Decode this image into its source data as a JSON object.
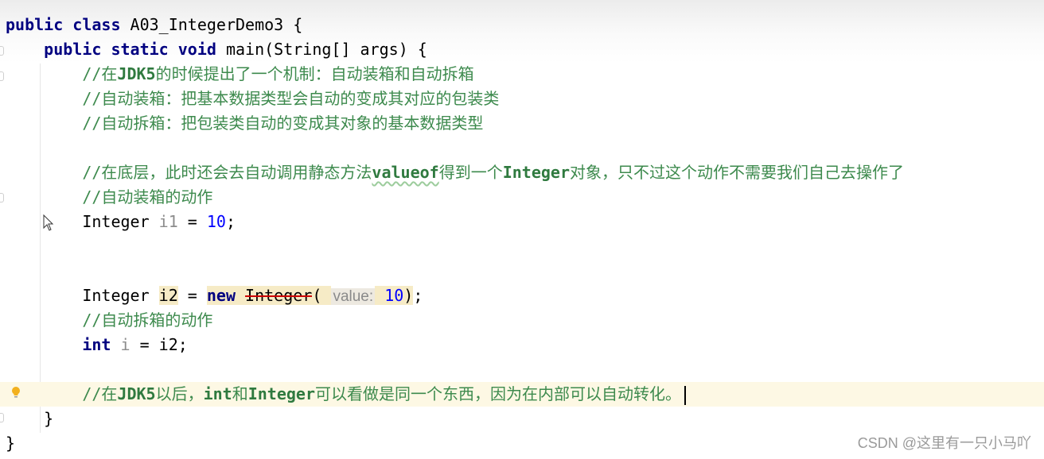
{
  "editor": {
    "current_line": 15,
    "colors": {
      "keyword": "#000080",
      "comment": "#3d8a4d",
      "number": "#0000ff",
      "current_line_bg": "#fdf8e4",
      "highlight_bg": "#f6ebc6"
    },
    "lines": [
      [
        {
          "t": "public class ",
          "c": "kw"
        },
        {
          "t": "A03_IntegerDemo3 {",
          "c": "pl"
        }
      ],
      [
        {
          "t": "    "
        },
        {
          "t": "public static void ",
          "c": "kw"
        },
        {
          "t": "main(String[] args) {",
          "c": "pl"
        }
      ],
      [
        {
          "t": "        "
        },
        {
          "t": "//在",
          "c": "cm"
        },
        {
          "t": "JDK5",
          "c": "cmb"
        },
        {
          "t": "的时候提出了一个机制：自动装箱和自动拆箱",
          "c": "cm"
        }
      ],
      [
        {
          "t": "        "
        },
        {
          "t": "//自动装箱：把基本数据类型会自动的变成其对应的包装类",
          "c": "cm"
        }
      ],
      [
        {
          "t": "        "
        },
        {
          "t": "//自动拆箱：把包装类自动的变成其对象的基本数据类型",
          "c": "cm"
        }
      ],
      [],
      [
        {
          "t": "        "
        },
        {
          "t": "//在底层，此时还会去自动调用静态方法",
          "c": "cm"
        },
        {
          "t": "valueof",
          "c": "cmb wavy"
        },
        {
          "t": "得到一个",
          "c": "cm"
        },
        {
          "t": "Integer",
          "c": "cmb"
        },
        {
          "t": "对象，只不过这个动作不需要我们自己去操作了",
          "c": "cm"
        }
      ],
      [
        {
          "t": "        "
        },
        {
          "t": "//自动装箱的动作",
          "c": "cm"
        }
      ],
      [
        {
          "t": "        "
        },
        {
          "t": "Integer ",
          "c": "pl"
        },
        {
          "t": "i1",
          "c": "unused"
        },
        {
          "t": " = ",
          "c": "pl"
        },
        {
          "t": "10",
          "c": "num"
        },
        {
          "t": ";",
          "c": "pl"
        }
      ],
      [],
      [],
      [
        {
          "t": "        "
        },
        {
          "t": "Integer ",
          "c": "pl"
        },
        {
          "t": "i2",
          "c": "pl hl"
        },
        {
          "t": " = ",
          "c": "pl"
        },
        {
          "t": "new ",
          "c": "kw hl"
        },
        {
          "t": "Integer",
          "c": "pl hl strike"
        },
        {
          "t": "( ",
          "c": "pl hl"
        },
        {
          "t": "value:",
          "c": "hint"
        },
        {
          "t": " ",
          "c": "pl hl"
        },
        {
          "t": "10",
          "c": "num hl"
        },
        {
          "t": ")",
          "c": "pl hl"
        },
        {
          "t": ";",
          "c": "pl"
        }
      ],
      [
        {
          "t": "        "
        },
        {
          "t": "//自动拆箱的动作",
          "c": "cm"
        }
      ],
      [
        {
          "t": "        "
        },
        {
          "t": "int ",
          "c": "kw"
        },
        {
          "t": "i",
          "c": "unused"
        },
        {
          "t": " = i2;",
          "c": "pl"
        }
      ],
      [],
      [
        {
          "t": "        "
        },
        {
          "t": "//在",
          "c": "cm"
        },
        {
          "t": "JDK5",
          "c": "cmb"
        },
        {
          "t": "以后，",
          "c": "cm"
        },
        {
          "t": "int",
          "c": "cmb"
        },
        {
          "t": "和",
          "c": "cm"
        },
        {
          "t": "Integer",
          "c": "cmb"
        },
        {
          "t": "可以看做是同一个东西，因为在内部可以自动转化。",
          "c": "cm"
        }
      ],
      [
        {
          "t": "    "
        },
        {
          "t": "}",
          "c": "pl"
        }
      ],
      [
        {
          "t": "}",
          "c": "pl"
        }
      ]
    ]
  },
  "icons": {
    "bulb": "lightbulb-icon",
    "cursor": "mouse-pointer-icon",
    "fold": "fold-marker-icon"
  },
  "watermark": "CSDN @这里有一只小马吖"
}
